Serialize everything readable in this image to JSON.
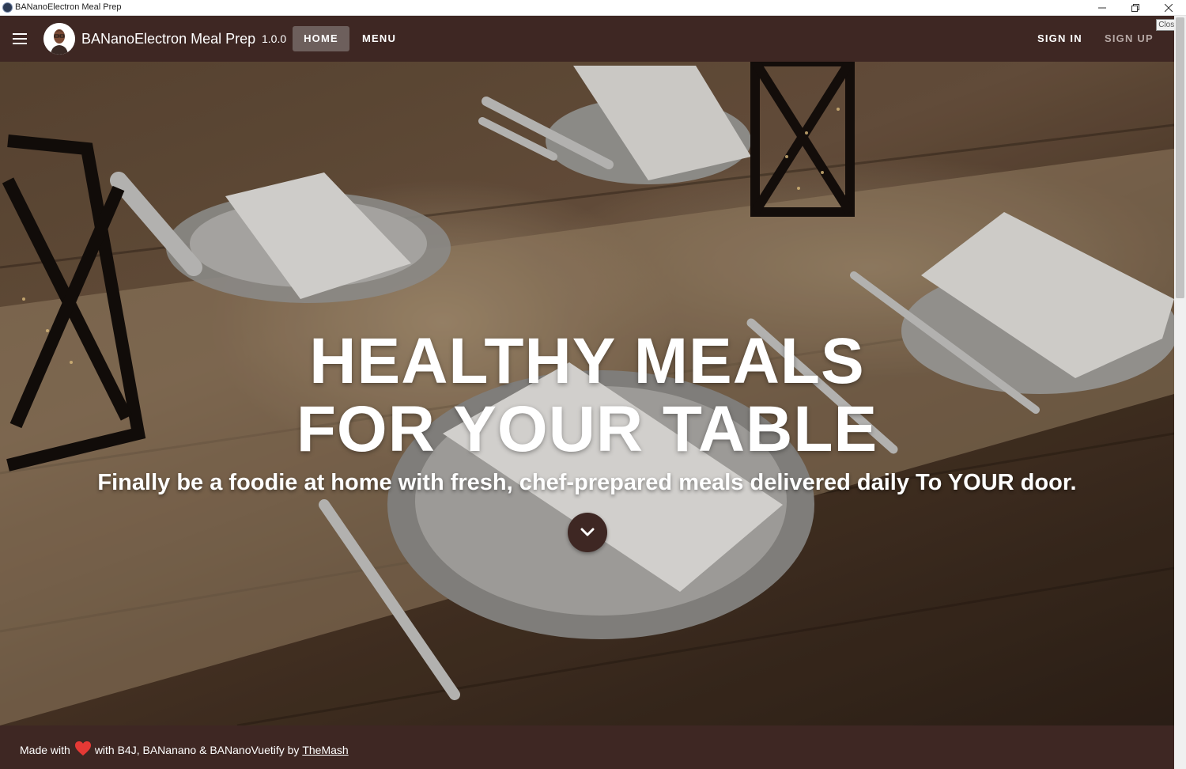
{
  "window": {
    "title": "BANanoElectron Meal Prep",
    "controls": [
      "minimize-icon",
      "restore-icon",
      "close-icon"
    ],
    "tooltip": "Close"
  },
  "appbar": {
    "brand": "BANanoElectron Meal Prep",
    "version": "1.0.0",
    "nav": {
      "home": "HOME",
      "menu": "MENU",
      "sign_in": "SIGN IN",
      "sign_up": "SIGN UP"
    },
    "active_nav": "home"
  },
  "hero": {
    "headline_line1": "HEALTHY MEALS",
    "headline_line2": "FOR YOUR TABLE",
    "subtitle": "Finally be a foodie at home with fresh, chef-prepared meals delivered daily To YOUR door.",
    "scroll_button_icon": "chevron-down-icon"
  },
  "footer": {
    "made_with": "Made with",
    "credits": "with B4J, BANanano & BANanoVuetify by",
    "author_link": "TheMash"
  },
  "colors": {
    "primary": "#3e2723",
    "active_tab": "#6d5f5c",
    "sign_up_text": "#b7a9a6",
    "heart": "#e53935"
  }
}
